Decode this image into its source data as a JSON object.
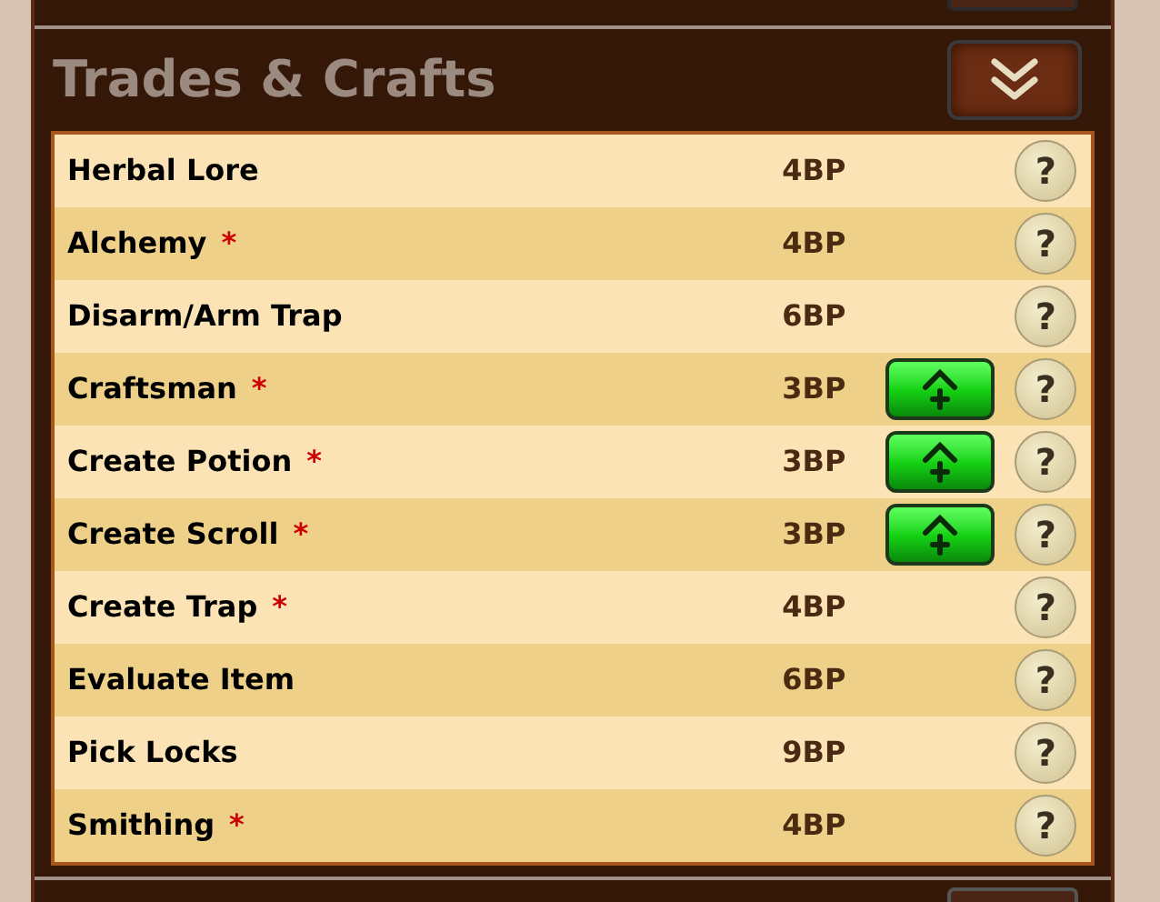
{
  "section": {
    "title": "Trades & Crafts",
    "collapse_expanded": true
  },
  "skills": [
    {
      "name": "Herbal Lore",
      "cost": "4BP",
      "upgradable": false,
      "help": "?"
    },
    {
      "name": "Alchemy",
      "asterisk": "*",
      "cost": "4BP",
      "upgradable": false,
      "help": "?"
    },
    {
      "name": "Disarm/Arm Trap",
      "cost": "6BP",
      "upgradable": false,
      "help": "?"
    },
    {
      "name": "Craftsman",
      "asterisk": "*",
      "cost": "3BP",
      "upgradable": true,
      "help": "?"
    },
    {
      "name": "Create Potion",
      "asterisk": "*",
      "cost": "3BP",
      "upgradable": true,
      "help": "?"
    },
    {
      "name": "Create Scroll",
      "asterisk": "*",
      "cost": "3BP",
      "upgradable": true,
      "help": "?"
    },
    {
      "name": "Create Trap",
      "asterisk": "*",
      "cost": "4BP",
      "upgradable": false,
      "help": "?"
    },
    {
      "name": "Evaluate Item",
      "cost": "6BP",
      "upgradable": false,
      "help": "?"
    },
    {
      "name": "Pick Locks",
      "cost": "9BP",
      "upgradable": false,
      "help": "?"
    },
    {
      "name": "Smithing",
      "asterisk": "*",
      "cost": "4BP",
      "upgradable": false,
      "help": "?"
    }
  ]
}
